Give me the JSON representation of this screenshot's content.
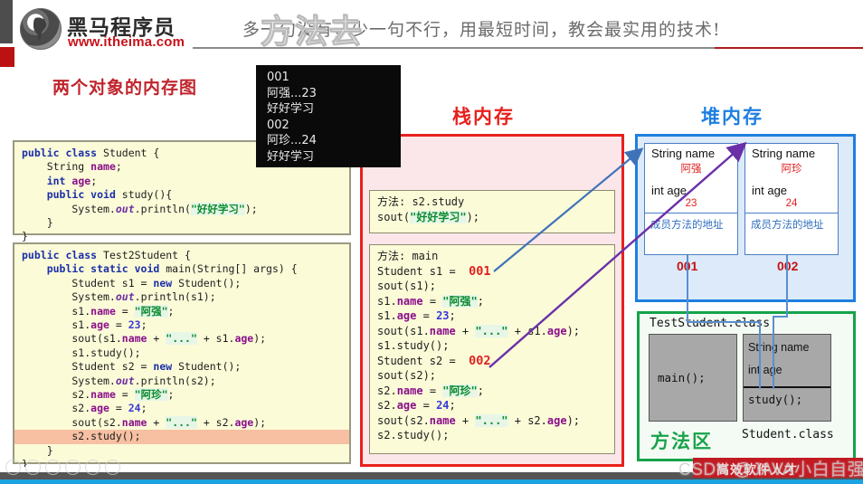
{
  "header": {
    "logo_cn": "黑马程序员",
    "logo_url": "www.itheima.com",
    "slogan": "多一句没有，少一句不行，用最短时间，教会最实用的技术!",
    "overlay_text": "方法去"
  },
  "titles": {
    "left": "两个对象的内存图",
    "stack": "栈内存",
    "heap": "堆内存",
    "method_area": "方法区"
  },
  "console": {
    "lines": [
      "001",
      "阿强...23",
      "好好学习",
      "002",
      "阿珍...24",
      "好好学习"
    ]
  },
  "code_blocks": {
    "student_class": {
      "lines": [
        "public class Student {",
        "    String name;",
        "    int age;",
        "    public void study(){",
        "        System.out.println(\"好好学习\");",
        "    }",
        "}"
      ]
    },
    "test_class": {
      "lines": [
        "public class Test2Student {",
        "    public static void main(String[] args) {",
        "        Student s1 = new Student();",
        "        System.out.println(s1);",
        "        s1.name = \"阿强\";",
        "        s1.age = 23;",
        "        sout(s1.name + \"...\" + s1.age);",
        "        s1.study();",
        "        Student s2 = new Student();",
        "        System.out.println(s2);",
        "        s2.name = \"阿珍\";",
        "        s2.age = 24;",
        "        sout(s2.name + \"...\" + s2.age);",
        "        s2.study();",
        "    }",
        "}"
      ],
      "highlighted_line": "        s2.study();"
    }
  },
  "stack": {
    "frame_study": {
      "title": "方法: s2.study",
      "body": "sout(\"好好学习\");"
    },
    "frame_main": {
      "title": "方法: main",
      "lines": [
        "Student s1 = ",
        "sout(s1);",
        "s1.name = \"阿强\";",
        "s1.age = 23;",
        "sout(s1.name + \"...\" + s1.age);",
        "s1.study();",
        "Student s2 = ",
        "sout(s2);",
        "s2.name = \"阿珍\";",
        "s2.age = 24;",
        "sout(s2.name + \"...\" + s2.age);",
        "s2.study();"
      ],
      "address_s1": "001",
      "address_s2": "002"
    }
  },
  "heap": {
    "objects": [
      {
        "field_name": "String name",
        "value_name": "阿强",
        "field_age": "int age",
        "value_age": "23",
        "method_addr": "成员方法的地址",
        "id": "001"
      },
      {
        "field_name": "String name",
        "value_name": "阿珍",
        "field_age": "int age",
        "value_age": "24",
        "method_addr": "成员方法的地址",
        "id": "002"
      }
    ]
  },
  "method_area": {
    "test_class_label": "TestStudent.class",
    "main_method": "main();",
    "student_field_name": "String name",
    "student_field_age": "int age",
    "student_method": "study();",
    "student_class_label": "Student.class"
  },
  "footer": {
    "banner_text": "高效软件人才",
    "watermark": "CSDN @JAVA小白自强家"
  },
  "colors": {
    "stack_border": "#e8201c",
    "heap_border": "#1f7fe0",
    "method_border": "#17a34a",
    "brand_red": "#c7131a",
    "address_red": "#e02020"
  }
}
